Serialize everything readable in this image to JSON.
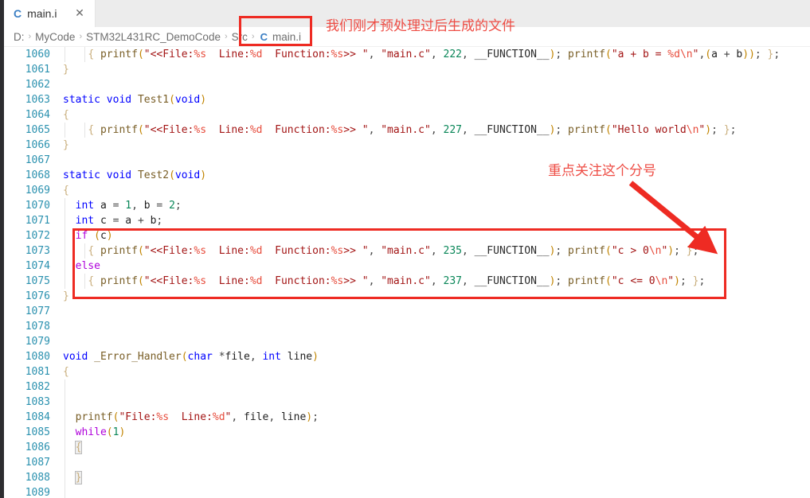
{
  "window": {
    "tab": {
      "icon": "c-file-icon",
      "label": "main.i",
      "close": "✕"
    }
  },
  "breadcrumb": {
    "segments": [
      "D:",
      "MyCode",
      "STM32L431RC_DemoCode",
      "Src"
    ],
    "separator": "›",
    "file_icon": "c-file-icon",
    "file": "main.i"
  },
  "annotations": [
    {
      "name": "file-note",
      "text": "我们刚才预处理过后生成的文件",
      "color": "#ee4d45"
    },
    {
      "name": "semicolon-note",
      "text": "重点关注这个分号",
      "color": "#ee4d45"
    }
  ],
  "highlight_color": "#ee2b23",
  "editor": {
    "first_line": 1060,
    "lines": [
      {
        "n": 1060,
        "indent": 3,
        "guides": [
          1,
          2
        ],
        "text": "    { printf(\"<<File:%s  Line:%d  Function:%s>> \", \"main.c\", 222, __FUNCTION__); printf(\"a + b = %d\\n\",(a + b)); };"
      },
      {
        "n": 1061,
        "indent": 0,
        "guides": [],
        "text": "}"
      },
      {
        "n": 1062,
        "indent": 0,
        "guides": [],
        "text": ""
      },
      {
        "n": 1063,
        "indent": 0,
        "guides": [],
        "text": "static void Test1(void)"
      },
      {
        "n": 1064,
        "indent": 0,
        "guides": [],
        "text": "{"
      },
      {
        "n": 1065,
        "indent": 3,
        "guides": [
          1,
          2
        ],
        "text": "    { printf(\"<<File:%s  Line:%d  Function:%s>> \", \"main.c\", 227, __FUNCTION__); printf(\"Hello world\\n\"); };"
      },
      {
        "n": 1066,
        "indent": 0,
        "guides": [],
        "text": "}"
      },
      {
        "n": 1067,
        "indent": 0,
        "guides": [],
        "text": ""
      },
      {
        "n": 1068,
        "indent": 0,
        "guides": [],
        "text": "static void Test2(void)"
      },
      {
        "n": 1069,
        "indent": 0,
        "guides": [],
        "text": "{"
      },
      {
        "n": 1070,
        "indent": 1,
        "guides": [
          1
        ],
        "text": "  int a = 1, b = 2;"
      },
      {
        "n": 1071,
        "indent": 1,
        "guides": [
          1
        ],
        "text": "  int c = a + b;"
      },
      {
        "n": 1072,
        "indent": 1,
        "guides": [
          1
        ],
        "text": "  if (c)"
      },
      {
        "n": 1073,
        "indent": 2,
        "guides": [
          1,
          2
        ],
        "text": "    { printf(\"<<File:%s  Line:%d  Function:%s>> \", \"main.c\", 235, __FUNCTION__); printf(\"c > 0\\n\"); };"
      },
      {
        "n": 1074,
        "indent": 1,
        "guides": [
          1
        ],
        "text": "  else"
      },
      {
        "n": 1075,
        "indent": 2,
        "guides": [
          1,
          2
        ],
        "text": "    { printf(\"<<File:%s  Line:%d  Function:%s>> \", \"main.c\", 237, __FUNCTION__); printf(\"c <= 0\\n\"); };"
      },
      {
        "n": 1076,
        "indent": 0,
        "guides": [],
        "text": "}"
      },
      {
        "n": 1077,
        "indent": 0,
        "guides": [],
        "text": ""
      },
      {
        "n": 1078,
        "indent": 0,
        "guides": [],
        "text": ""
      },
      {
        "n": 1079,
        "indent": 0,
        "guides": [],
        "text": ""
      },
      {
        "n": 1080,
        "indent": 0,
        "guides": [],
        "text": "void _Error_Handler(char *file, int line)"
      },
      {
        "n": 1081,
        "indent": 0,
        "guides": [],
        "text": "{"
      },
      {
        "n": 1082,
        "indent": 1,
        "guides": [
          1
        ],
        "text": ""
      },
      {
        "n": 1083,
        "indent": 1,
        "guides": [
          1
        ],
        "text": ""
      },
      {
        "n": 1084,
        "indent": 1,
        "guides": [
          1
        ],
        "text": "  printf(\"File:%s  Line:%d\", file, line);"
      },
      {
        "n": 1085,
        "indent": 1,
        "guides": [
          1
        ],
        "text": "  while(1)"
      },
      {
        "n": 1086,
        "indent": 1,
        "guides": [
          1
        ],
        "text": "  {"
      },
      {
        "n": 1087,
        "indent": 1,
        "guides": [
          1
        ],
        "text": ""
      },
      {
        "n": 1088,
        "indent": 1,
        "guides": [
          1
        ],
        "text": "  }"
      },
      {
        "n": 1089,
        "indent": 1,
        "guides": [
          1
        ],
        "text": ""
      }
    ]
  }
}
